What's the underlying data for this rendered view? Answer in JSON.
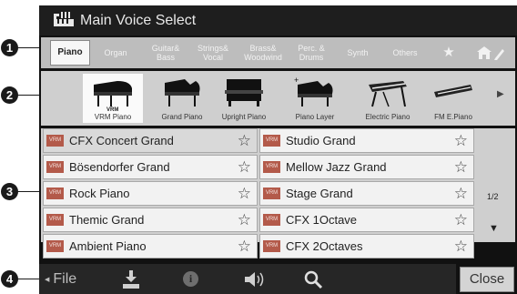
{
  "title": "Main Voice Select",
  "callouts": [
    "1",
    "2",
    "3",
    "4"
  ],
  "category_tabs": [
    {
      "label": "Piano",
      "active": true
    },
    {
      "label": "Organ"
    },
    {
      "label": "Guitar&\nBass"
    },
    {
      "label": "Strings&\nVocal"
    },
    {
      "label": "Brass&\nWoodwind"
    },
    {
      "label": "Perc. &\nDrums"
    },
    {
      "label": "Synth"
    },
    {
      "label": "Others"
    },
    {
      "label": "★"
    },
    {
      "label": ""
    }
  ],
  "sub_categories": [
    {
      "label": "VRM Piano",
      "badge": "VRM",
      "active": true
    },
    {
      "label": "Grand Piano"
    },
    {
      "label": "Upright Piano"
    },
    {
      "label": "Piano Layer"
    },
    {
      "label": "Electric Piano"
    },
    {
      "label": "FM E.Piano"
    }
  ],
  "next_arrow": "▶",
  "voices_left": [
    {
      "badge": "VRM",
      "name": "CFX Concert Grand",
      "selected": true
    },
    {
      "badge": "VRM",
      "name": "Bösendorfer Grand"
    },
    {
      "badge": "VRM",
      "name": "Rock Piano"
    },
    {
      "badge": "VRM",
      "name": "Themic Grand"
    },
    {
      "badge": "VRM",
      "name": "Ambient Piano"
    }
  ],
  "voices_right": [
    {
      "badge": "VRM",
      "name": "Studio Grand"
    },
    {
      "badge": "VRM",
      "name": "Mellow Jazz Grand"
    },
    {
      "badge": "VRM",
      "name": "Stage Grand"
    },
    {
      "badge": "VRM",
      "name": "CFX 1Octave"
    },
    {
      "badge": "VRM",
      "name": "CFX 2Octaves"
    }
  ],
  "star_glyph": "☆",
  "page": "1/2",
  "page_down": "▼",
  "bottom": {
    "file_label": "File",
    "file_icon": "folder-arrow-icon",
    "save_icon": "save-icon",
    "info_icon": "info-icon",
    "info_glyph": "i",
    "volume_icon": "speaker-icon",
    "search_icon": "search-icon",
    "close_label": "Close"
  },
  "colors": {
    "frame": "#111111",
    "vrm_badge": "#b35a4a",
    "active_tab": "#f7f7f7"
  }
}
